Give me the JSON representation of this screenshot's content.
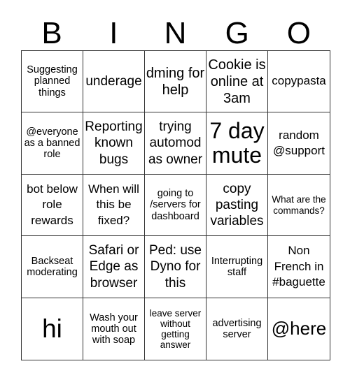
{
  "header": {
    "letters": [
      "B",
      "I",
      "N",
      "G",
      "O"
    ]
  },
  "cells": [
    "Suggesting planned things",
    "underage",
    "dming for help",
    "Cookie is online at 3am",
    "copypasta",
    "@everyone as a banned role",
    "Reporting known bugs",
    "trying automod as owner",
    "7 day mute",
    "random @support",
    "bot below role rewards",
    "When will this be fixed?",
    "going to /servers for dashboard",
    "copy pasting variables",
    "What are the commands?",
    "Backseat moderating",
    "Safari or Edge as browser",
    "Ped: use Dyno for this",
    "Interrupting staff",
    "Non French in #baguette",
    "hi",
    "Wash your mouth out with soap",
    "leave server without getting answer",
    "advertising server",
    "@here"
  ]
}
